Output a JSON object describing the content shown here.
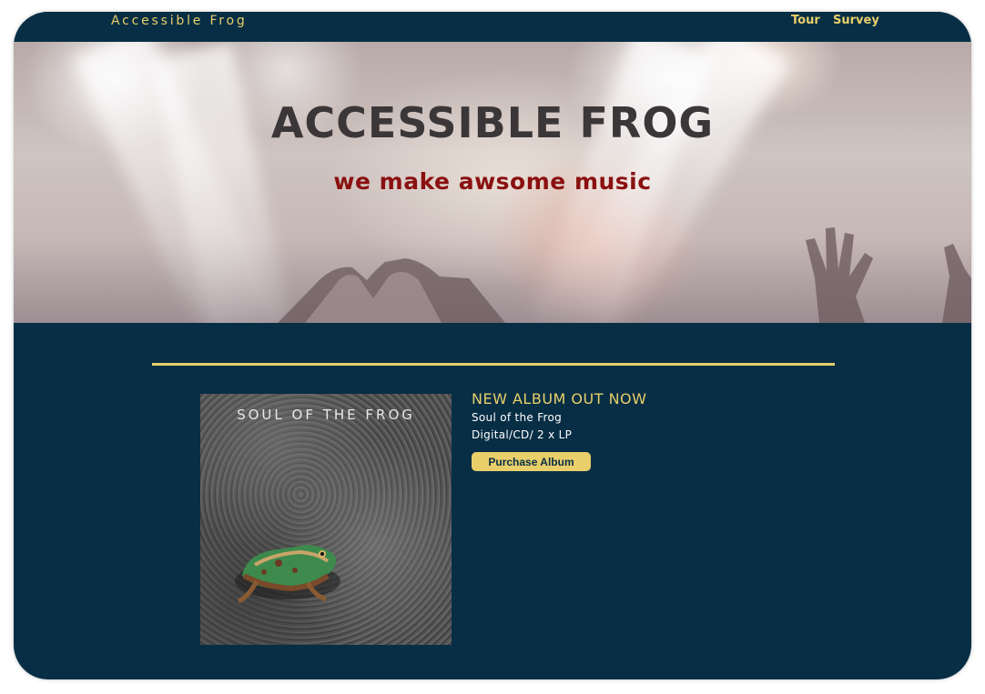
{
  "navbar": {
    "brand": "Accessible Frog",
    "links": [
      "Tour",
      "Survey"
    ]
  },
  "hero": {
    "title": "ACCESSIBLE FROG",
    "subtitle": "we make awsome music"
  },
  "album": {
    "cover_title": "SOUL OF THE FROG",
    "heading": "NEW ALBUM OUT NOW",
    "name": "Soul of the Frog",
    "formats": "Digital/CD/ 2 x LP",
    "purchase_label": "Purchase Album"
  },
  "colors": {
    "page_background": "#072e45",
    "accent_gold": "#e9cf6a",
    "subtitle_red": "#8a1010",
    "title_gray": "#3b3738"
  }
}
